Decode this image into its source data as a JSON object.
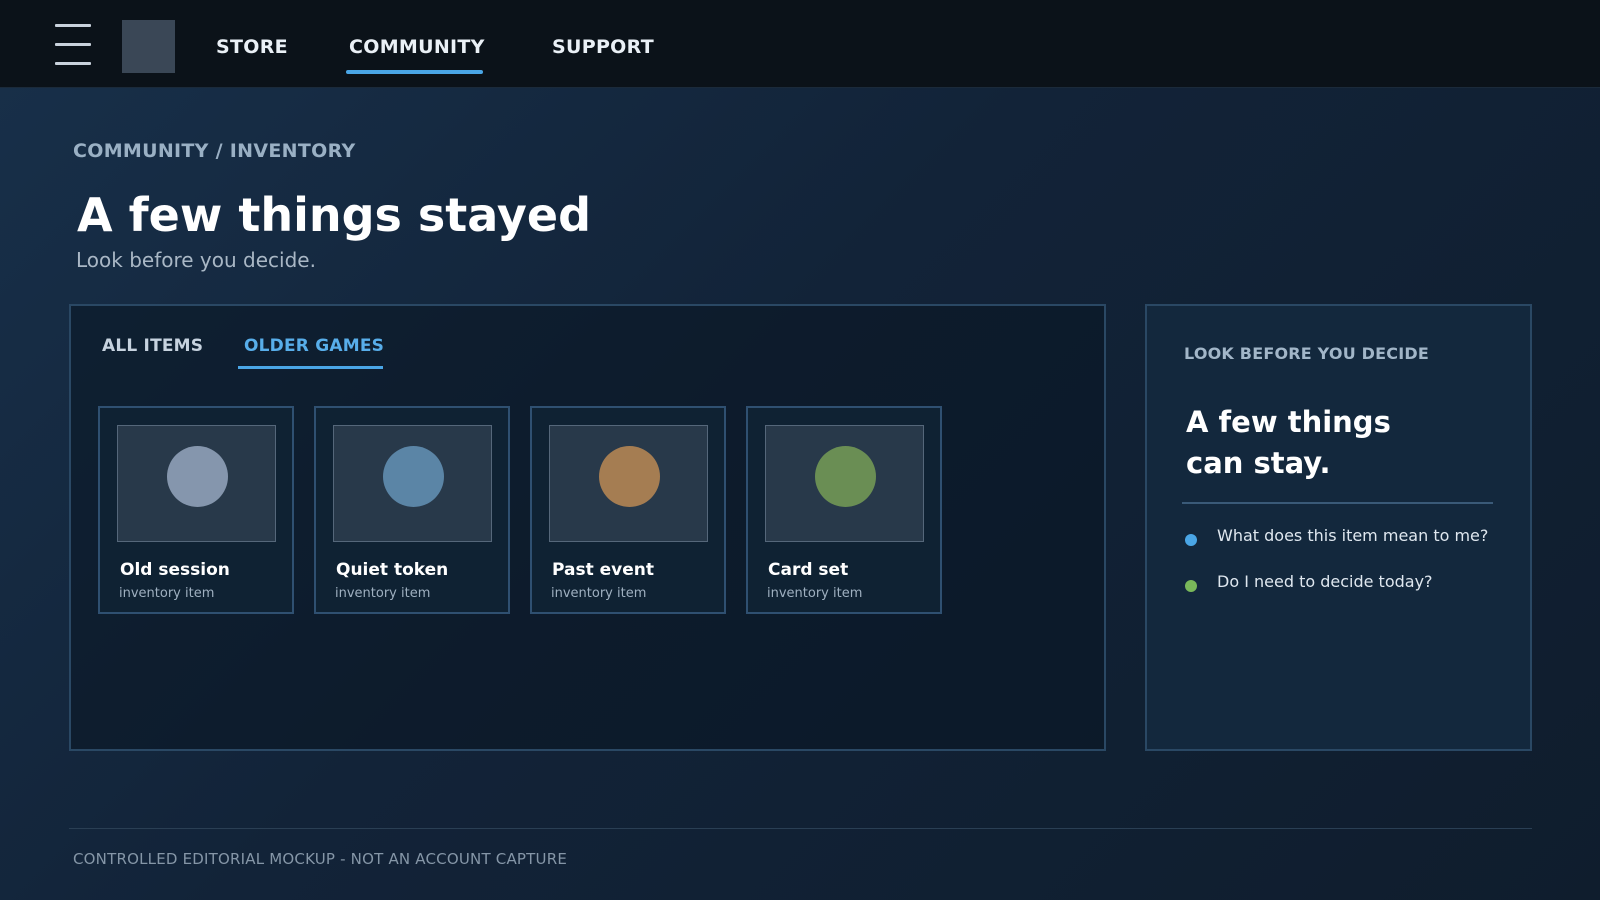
{
  "nav": {
    "items": [
      {
        "label": "STORE",
        "active": false
      },
      {
        "label": "COMMUNITY",
        "active": true
      },
      {
        "label": "SUPPORT",
        "active": false
      }
    ],
    "menu_icon": "hamburger-icon",
    "logo_icon": "logo-placeholder"
  },
  "breadcrumb": "COMMUNITY / INVENTORY",
  "page": {
    "title": "A few things stayed",
    "subtitle": "Look before you decide."
  },
  "tabs": [
    {
      "label": "ALL ITEMS",
      "active": false
    },
    {
      "label": "OLDER GAMES",
      "active": true
    }
  ],
  "items": [
    {
      "name": "Old session",
      "type": "inventory item",
      "color": "#8596ad"
    },
    {
      "name": "Quiet token",
      "type": "inventory item",
      "color": "#5b85a6"
    },
    {
      "name": "Past event",
      "type": "inventory item",
      "color": "#a57d52"
    },
    {
      "name": "Card set",
      "type": "inventory item",
      "color": "#6a8e54"
    }
  ],
  "side": {
    "kicker": "LOOK BEFORE YOU DECIDE",
    "heading_line1": "A few things",
    "heading_line2": "can stay.",
    "questions": [
      {
        "text": "What does this item mean to me?",
        "color": "#4aa6e6"
      },
      {
        "text": "Do I need to decide today?",
        "color": "#79b85a"
      }
    ]
  },
  "footer": "CONTROLLED EDITORIAL MOCKUP - NOT AN ACCOUNT CAPTURE",
  "colors": {
    "accent": "#4aa6e6",
    "background": "#122338",
    "topbar": "#0b1219"
  }
}
